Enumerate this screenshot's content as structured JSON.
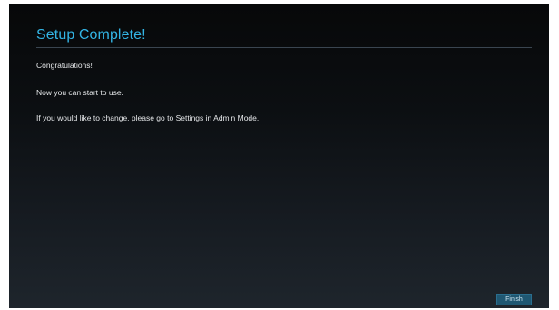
{
  "dialog": {
    "title": "Setup Complete!",
    "lines": [
      "Congratulations!",
      "Now you can start to use.",
      "If you would like to change, please go to Settings in Admin Mode."
    ],
    "finish_label": "Finish"
  },
  "colors": {
    "title": "#33b5e5",
    "button": "#1f5772",
    "background": "#0c0f12"
  }
}
